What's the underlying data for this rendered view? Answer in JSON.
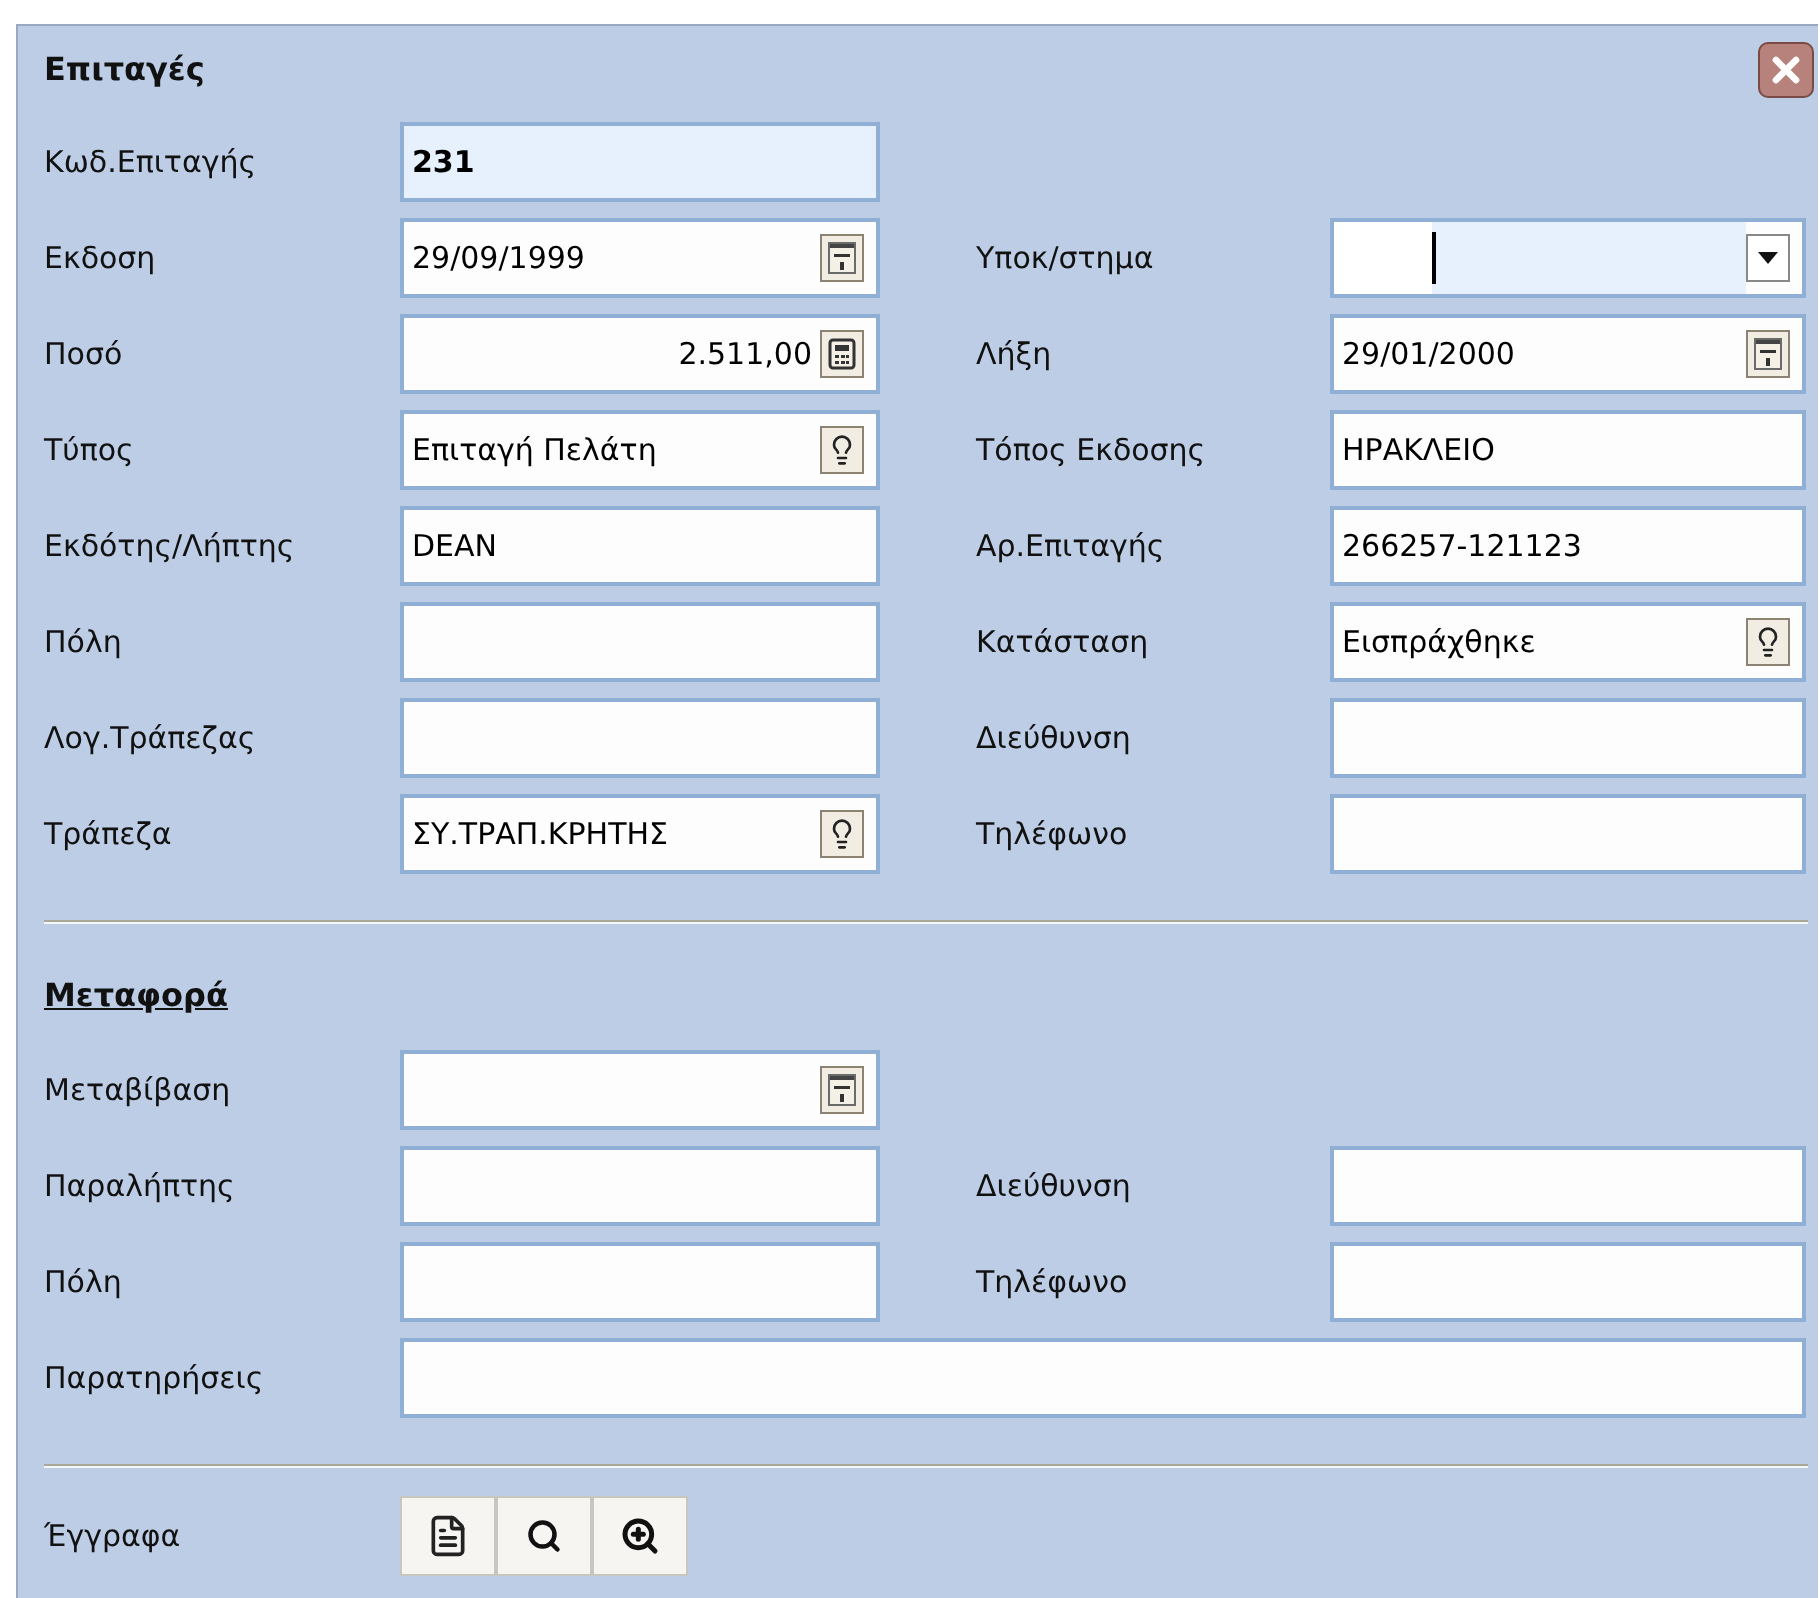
{
  "window": {
    "title": "Επιταγές"
  },
  "main_rows": [
    {
      "left": {
        "label": "Κωδ.Επιταγής",
        "value": "231",
        "kind": "code"
      }
    },
    {
      "left": {
        "label": "Εκδοση",
        "value": "29/09/1999",
        "kind": "date"
      },
      "right": {
        "label": "Υποκ/στημα",
        "kind": "combo",
        "focused": true
      }
    },
    {
      "left": {
        "label": "Ποσό",
        "value": "2.511,00",
        "kind": "amount"
      },
      "right": {
        "label": "Λήξη",
        "value": "29/01/2000",
        "kind": "date"
      }
    },
    {
      "left": {
        "label": "Τύπος",
        "value": "Επιταγή Πελάτη",
        "kind": "lookup"
      },
      "right": {
        "label": "Τόπος Εκδοσης",
        "value": "ΗΡΑΚΛΕΙΟ",
        "kind": "text"
      }
    },
    {
      "left": {
        "label": "Εκδότης/Λήπτης",
        "value": "DEAN",
        "kind": "text"
      },
      "right": {
        "label": "Αρ.Επιταγής",
        "value": "266257-121123",
        "kind": "text"
      }
    },
    {
      "left": {
        "label": "Πόλη",
        "kind": "text"
      },
      "right": {
        "label": "Κατάσταση",
        "value": "Εισπράχθηκε",
        "kind": "lookup"
      }
    },
    {
      "left": {
        "label": "Λογ.Τράπεζας",
        "kind": "text"
      },
      "right": {
        "label": "Διεύθυνση",
        "kind": "text"
      }
    },
    {
      "left": {
        "label": "Τράπεζα",
        "value": "ΣΥ.ΤΡΑΠ.ΚΡΗΤΗΣ",
        "kind": "lookup"
      },
      "right": {
        "label": "Τηλέφωνο",
        "kind": "text"
      }
    }
  ],
  "transfer": {
    "title": "Μεταφορά",
    "rows": [
      {
        "left": {
          "label": "Μεταβίβαση",
          "kind": "date"
        }
      },
      {
        "left": {
          "label": "Παραλήπτης",
          "kind": "text"
        },
        "right": {
          "label": "Διεύθυνση",
          "kind": "text"
        }
      },
      {
        "left": {
          "label": "Πόλη",
          "kind": "text"
        },
        "right": {
          "label": "Τηλέφωνο",
          "kind": "text"
        }
      },
      {
        "left": {
          "label": "Παρατηρήσεις",
          "kind": "memo"
        }
      }
    ]
  },
  "documents": {
    "label": "Έγγραφα",
    "buttons": [
      {
        "kind": "document"
      },
      {
        "kind": "search"
      },
      {
        "kind": "add-search"
      }
    ]
  }
}
